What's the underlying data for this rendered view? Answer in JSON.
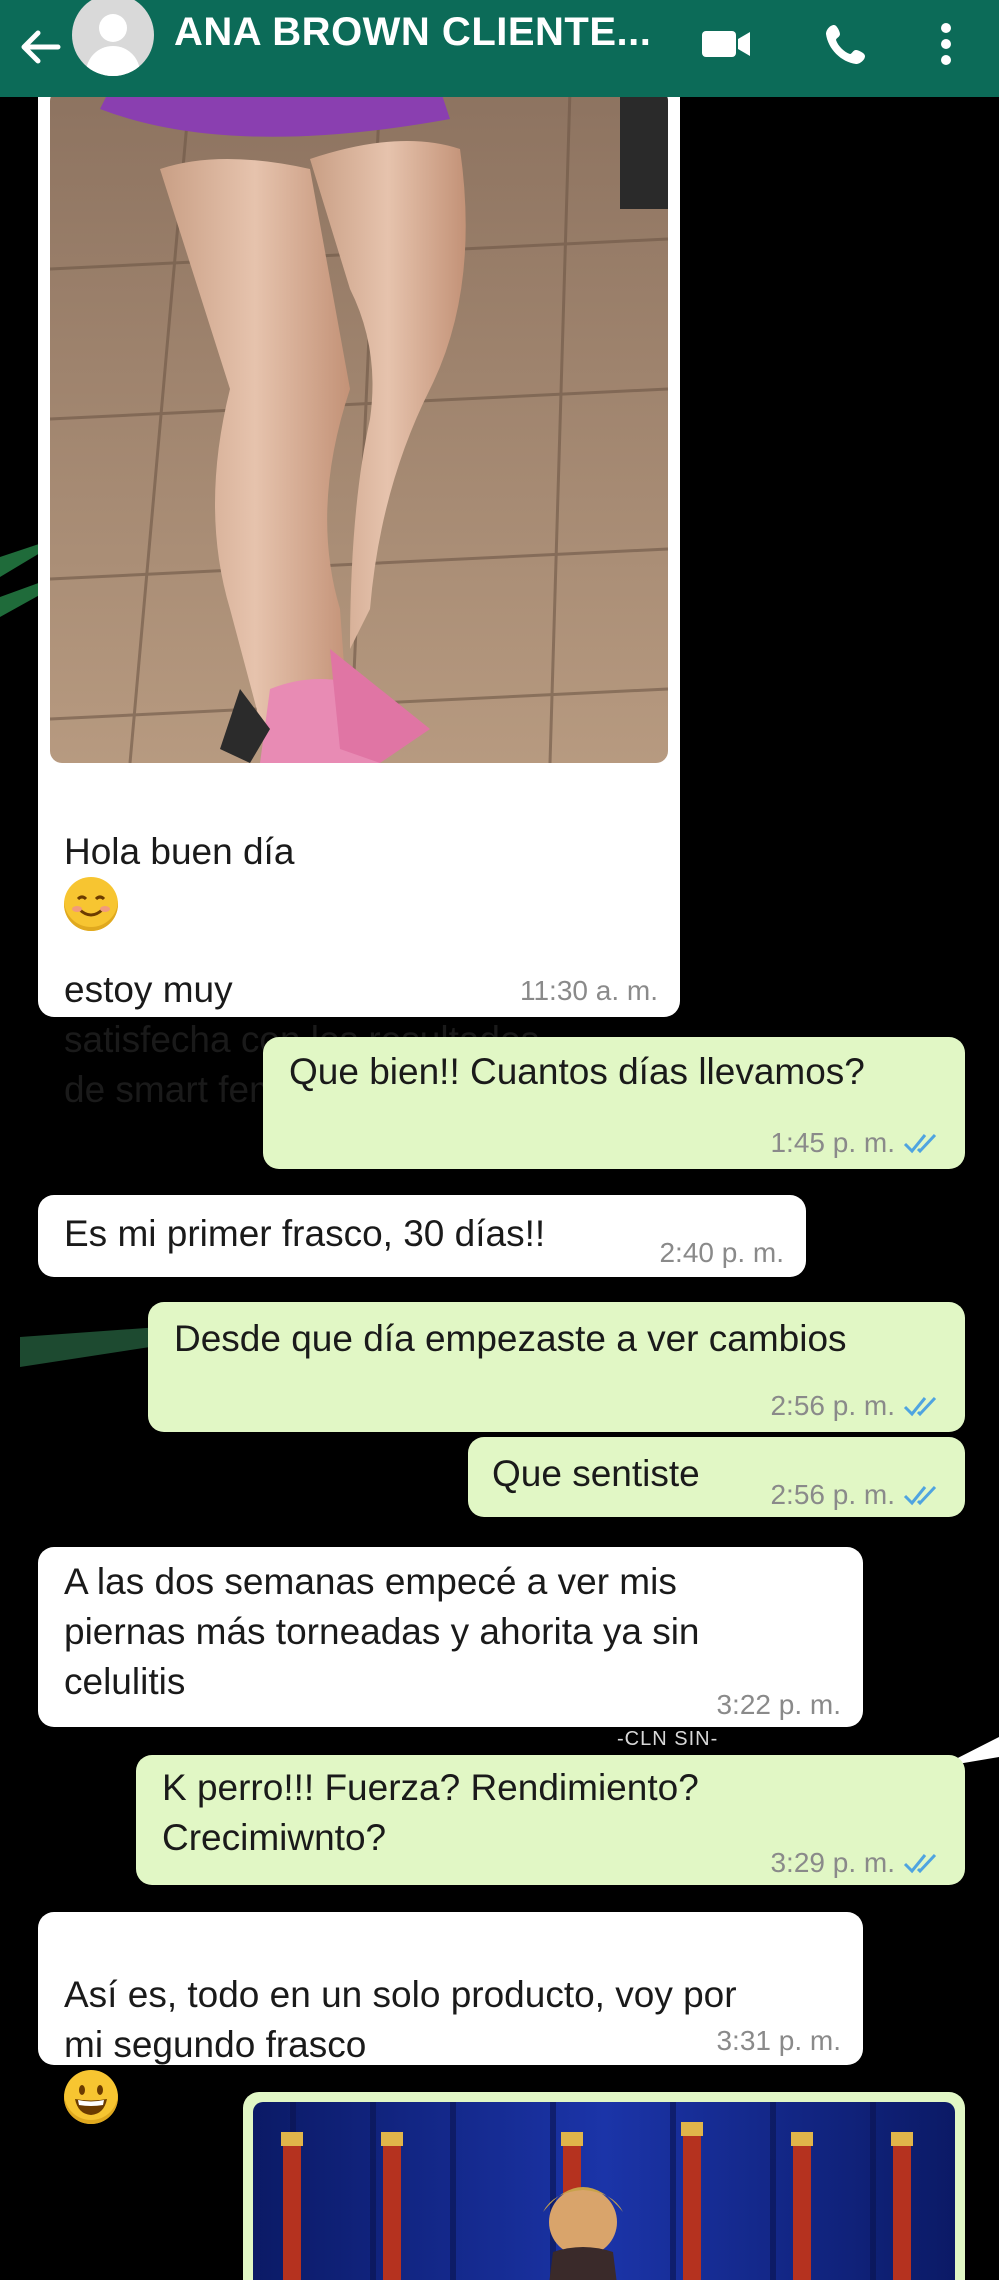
{
  "header": {
    "title": "ANA BROWN CLIENTE...",
    "back_icon": "arrow-left-icon",
    "video_icon": "video-camera-icon",
    "call_icon": "phone-icon",
    "menu_icon": "more-vertical-icon",
    "bg_color": "#0c6b58"
  },
  "colors": {
    "incoming": "#ffffff",
    "outgoing": "#e1f7c5",
    "read_ticks": "#4fa4e0",
    "time": "#8a8a8a"
  },
  "messages": [
    {
      "dir": "in",
      "text_before": "Hola buen día",
      "emoji": "smiling-face-emoji",
      "text_after": "estoy muy\nsatisfecha con los resultados\nde  smart femme, gracias!!",
      "time": "11:30 a. m.",
      "has_photo": true
    },
    {
      "dir": "out",
      "text": "Que bien!! Cuantos días llevamos?",
      "time": "1:45 p. m."
    },
    {
      "dir": "in",
      "text": "Es mi primer frasco, 30 días!!",
      "time": "2:40 p. m."
    },
    {
      "dir": "out",
      "text": "Desde que día empezaste a ver cambios",
      "time": "2:56 p. m."
    },
    {
      "dir": "out",
      "text": "Que sentiste",
      "time": "2:56 p. m."
    },
    {
      "dir": "in",
      "text": "A las dos semanas empecé a ver mis\npiernas   más torneadas y ahorita ya sin\ncelulitis",
      "time": "3:22 p. m."
    },
    {
      "dir": "out",
      "text": "K perro!!! Fuerza? Rendimiento?\nCrecimiwnto?",
      "time": "3:29 p. m."
    },
    {
      "dir": "in",
      "text": "Así es, todo en un solo producto, voy por\nmi segundo frasco",
      "emoji": "grinning-face-emoji",
      "time": "3:31 p. m."
    },
    {
      "dir": "out",
      "has_photo": true,
      "photo": "trophy-stage-photo"
    }
  ],
  "overlay_text": "-CLN SIN-"
}
